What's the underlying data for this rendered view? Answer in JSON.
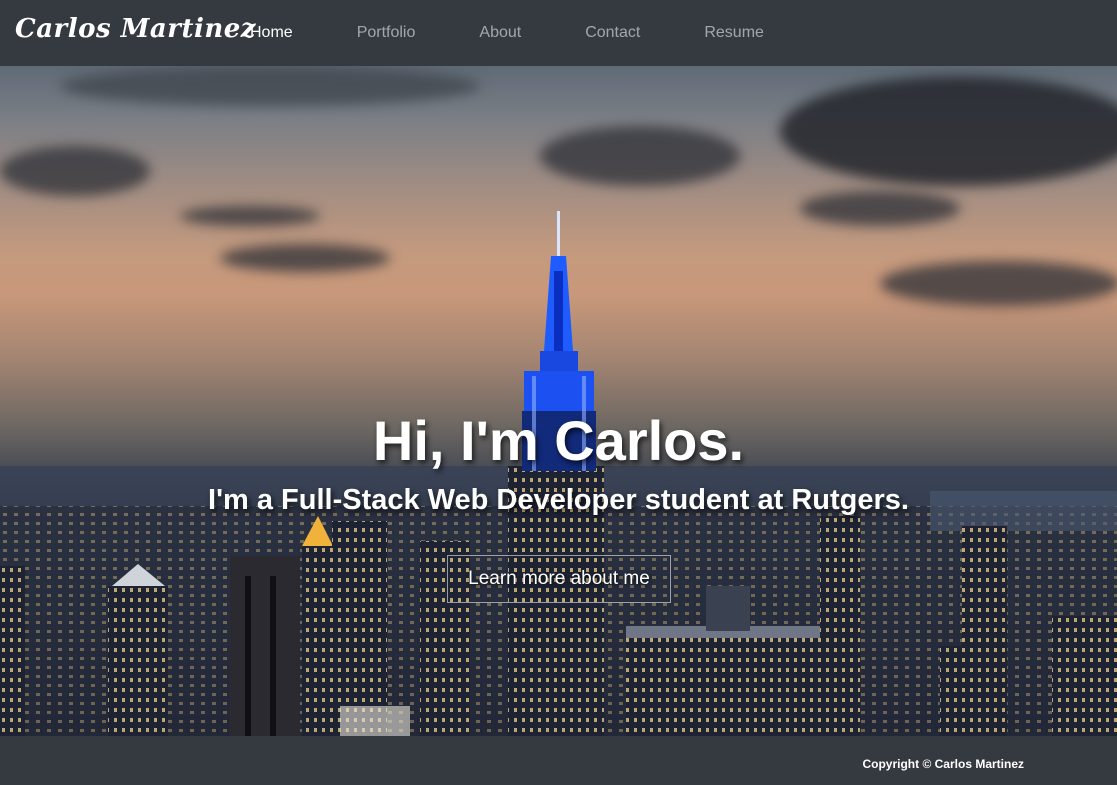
{
  "navbar": {
    "brand": "Carlos Martinez",
    "links": [
      {
        "label": "Home",
        "active": true
      },
      {
        "label": "Portfolio",
        "active": false
      },
      {
        "label": "About",
        "active": false
      },
      {
        "label": "Contact",
        "active": false
      },
      {
        "label": "Resume",
        "active": false
      }
    ]
  },
  "hero": {
    "title": "Hi, I'm Carlos.",
    "subtitle": "I'm a Full-Stack Web Developer student at Rutgers.",
    "button_label": "Learn more about me"
  },
  "footer": {
    "copyright": "Copyright © Carlos Martinez"
  },
  "colors": {
    "navbar_bg": "#343a40",
    "active_link": "#ffffff",
    "inactive_link": "rgba(255,255,255,0.55)",
    "spire_accent": "#1e5cff"
  }
}
